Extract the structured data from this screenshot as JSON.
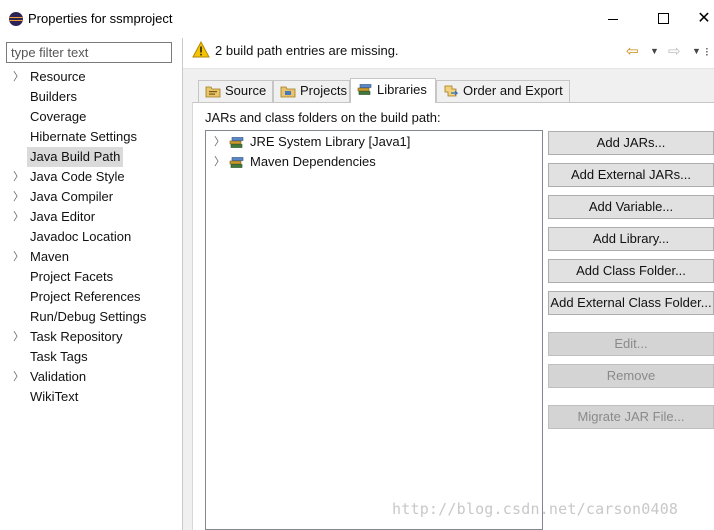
{
  "window": {
    "title": "Properties for ssmproject",
    "icon": "eclipse-icon"
  },
  "sidebar": {
    "filter_placeholder": "type filter text",
    "items": [
      {
        "label": "Resource",
        "expandable": true
      },
      {
        "label": "Builders",
        "expandable": false
      },
      {
        "label": "Coverage",
        "expandable": false
      },
      {
        "label": "Hibernate Settings",
        "expandable": false
      },
      {
        "label": "Java Build Path",
        "expandable": false,
        "selected": true
      },
      {
        "label": "Java Code Style",
        "expandable": true
      },
      {
        "label": "Java Compiler",
        "expandable": true
      },
      {
        "label": "Java Editor",
        "expandable": true
      },
      {
        "label": "Javadoc Location",
        "expandable": false
      },
      {
        "label": "Maven",
        "expandable": true
      },
      {
        "label": "Project Facets",
        "expandable": false
      },
      {
        "label": "Project References",
        "expandable": false
      },
      {
        "label": "Run/Debug Settings",
        "expandable": false
      },
      {
        "label": "Task Repository",
        "expandable": true
      },
      {
        "label": "Task Tags",
        "expandable": false
      },
      {
        "label": "Validation",
        "expandable": true
      },
      {
        "label": "WikiText",
        "expandable": false
      }
    ]
  },
  "header": {
    "message": "2 build path entries are missing.",
    "message_icon": "warning-icon"
  },
  "tabs": [
    {
      "label": "Source",
      "icon": "source-folder-icon"
    },
    {
      "label": "Projects",
      "icon": "projects-icon"
    },
    {
      "label": "Libraries",
      "icon": "libraries-icon",
      "active": true
    },
    {
      "label": "Order and Export",
      "icon": "order-export-icon"
    }
  ],
  "libraries": {
    "heading": "JARs and class folders on the build path:",
    "entries": [
      {
        "label": "JRE System Library [Java1]"
      },
      {
        "label": "Maven Dependencies"
      }
    ]
  },
  "buttons": {
    "add_jars": "Add JARs...",
    "add_external_jars": "Add External JARs...",
    "add_variable": "Add Variable...",
    "add_library": "Add Library...",
    "add_class_folder": "Add Class Folder...",
    "add_external_class_folder": "Add External Class Folder...",
    "edit": "Edit...",
    "remove": "Remove",
    "migrate_jar": "Migrate JAR File..."
  },
  "watermark": "http://blog.csdn.net/carson0408",
  "colors": {
    "warning": "#f5c400",
    "nav_back": "#c58a14"
  }
}
